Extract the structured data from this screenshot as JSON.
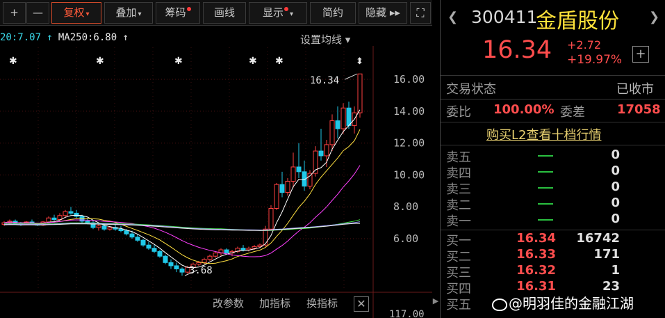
{
  "toolbar": {
    "buttons": [
      {
        "label": "+"
      },
      {
        "label": "—"
      },
      {
        "label": "复权",
        "caret": "▾"
      },
      {
        "label": "叠加",
        "caret": "▾"
      },
      {
        "label": "筹码"
      },
      {
        "label": "画线"
      },
      {
        "label": "显示",
        "caret": "▾"
      },
      {
        "label": "简约"
      },
      {
        "label": "隐藏 ▸▸"
      },
      {
        "label": "⛶"
      }
    ]
  },
  "chart": {
    "ma_legend": {
      "ma20": "20:7.07 ↑",
      "ma250": "MA250:6.80 ↑"
    },
    "ma_setting": "设置均线 ▾",
    "max_label": "16.34",
    "min_label": "3.68",
    "footer": {
      "params": "改参数",
      "add_indicator": "加指标",
      "switch_indicator": "换指标",
      "close": "✕"
    },
    "colors": {
      "up": "#ff4040",
      "down": "#20c8e8",
      "ma5": "#ffffff",
      "ma10": "#ffe040",
      "ma20": "#ff40ff",
      "ma60": "#40e040",
      "ma120": "#a0a0ff",
      "ma250": "#e8e8e8",
      "grid": "#5a1a1a"
    }
  },
  "chart_data": {
    "type": "candlestick",
    "yaxis_ticks": [
      "16.00",
      "14.00",
      "12.00",
      "10.00",
      "8.00",
      "6.00"
    ],
    "ylim": [
      5.0,
      16.8
    ],
    "bottom_tick": "117.00",
    "max_marker": 16.34,
    "min_marker": 3.68,
    "candles": [
      [
        6.9,
        7.1,
        6.8,
        7.0
      ],
      [
        7.0,
        7.2,
        6.9,
        7.1
      ],
      [
        7.1,
        7.2,
        6.9,
        6.95
      ],
      [
        6.95,
        7.05,
        6.8,
        6.9
      ],
      [
        6.9,
        7.1,
        6.85,
        7.05
      ],
      [
        7.05,
        7.2,
        6.9,
        6.95
      ],
      [
        6.95,
        7.0,
        6.8,
        6.85
      ],
      [
        6.85,
        7.1,
        6.8,
        7.05
      ],
      [
        7.05,
        7.4,
        7.0,
        7.3
      ],
      [
        7.3,
        7.5,
        7.1,
        7.2
      ],
      [
        7.2,
        7.6,
        7.1,
        7.45
      ],
      [
        7.45,
        7.8,
        7.3,
        7.7
      ],
      [
        7.7,
        8.0,
        7.5,
        7.6
      ],
      [
        7.6,
        7.8,
        7.3,
        7.4
      ],
      [
        7.4,
        7.5,
        7.0,
        7.1
      ],
      [
        7.1,
        7.3,
        6.9,
        7.0
      ],
      [
        7.0,
        7.1,
        6.6,
        6.7
      ],
      [
        6.7,
        6.9,
        6.5,
        6.8
      ],
      [
        6.8,
        6.9,
        6.5,
        6.6
      ],
      [
        6.6,
        6.8,
        6.5,
        6.7
      ],
      [
        6.7,
        6.9,
        6.5,
        6.6
      ],
      [
        6.6,
        6.8,
        6.4,
        6.5
      ],
      [
        6.5,
        6.6,
        6.2,
        6.3
      ],
      [
        6.3,
        6.5,
        6.0,
        6.1
      ],
      [
        6.1,
        6.3,
        5.8,
        5.9
      ],
      [
        5.9,
        6.0,
        5.5,
        5.6
      ],
      [
        5.6,
        5.8,
        5.3,
        5.4
      ],
      [
        5.4,
        5.6,
        5.1,
        5.2
      ],
      [
        5.2,
        5.3,
        4.8,
        4.9
      ],
      [
        4.9,
        5.0,
        4.4,
        4.5
      ],
      [
        4.5,
        4.7,
        4.1,
        4.3
      ],
      [
        4.3,
        4.5,
        3.9,
        4.1
      ],
      [
        4.1,
        4.2,
        3.68,
        3.9
      ],
      [
        3.9,
        4.3,
        3.8,
        4.2
      ],
      [
        4.2,
        4.5,
        4.1,
        4.4
      ],
      [
        4.4,
        4.6,
        4.3,
        4.5
      ],
      [
        4.5,
        4.8,
        4.4,
        4.7
      ],
      [
        4.7,
        5.0,
        4.6,
        4.9
      ],
      [
        4.9,
        5.2,
        4.8,
        5.1
      ],
      [
        5.1,
        5.4,
        4.9,
        5.3
      ],
      [
        5.3,
        5.4,
        5.0,
        5.1
      ],
      [
        5.1,
        5.3,
        4.9,
        5.2
      ],
      [
        5.2,
        5.5,
        5.1,
        5.4
      ],
      [
        5.4,
        5.6,
        5.2,
        5.3
      ],
      [
        5.3,
        5.5,
        5.2,
        5.4
      ],
      [
        5.4,
        5.6,
        5.3,
        5.5
      ],
      [
        5.5,
        5.7,
        5.4,
        5.6
      ],
      [
        5.6,
        6.8,
        5.5,
        6.6
      ],
      [
        6.6,
        8.1,
        6.5,
        7.9
      ],
      [
        7.9,
        9.5,
        7.8,
        9.4
      ],
      [
        9.4,
        10.2,
        8.6,
        8.9
      ],
      [
        8.9,
        9.8,
        8.7,
        9.6
      ],
      [
        9.6,
        11.4,
        9.2,
        10.5
      ],
      [
        10.5,
        12.0,
        9.8,
        10.2
      ],
      [
        10.2,
        10.9,
        9.0,
        9.3
      ],
      [
        9.3,
        10.3,
        9.1,
        10.1
      ],
      [
        10.1,
        11.8,
        9.9,
        11.5
      ],
      [
        11.5,
        12.9,
        10.9,
        11.2
      ],
      [
        11.2,
        12.2,
        10.5,
        11.9
      ],
      [
        11.9,
        13.8,
        11.5,
        13.4
      ],
      [
        13.4,
        14.3,
        12.3,
        12.9
      ],
      [
        12.9,
        14.5,
        12.6,
        14.2
      ],
      [
        14.2,
        14.6,
        12.9,
        13.1
      ],
      [
        13.1,
        14.3,
        12.6,
        13.9
      ],
      [
        13.9,
        16.34,
        13.6,
        16.34
      ]
    ]
  },
  "quote": {
    "prev_icon": "❮",
    "next_icon": "❯",
    "code": "300411",
    "name": "金盾股份",
    "price": "16.34",
    "change_abs": "+2.72",
    "change_pct": "+19.97%",
    "add_label": "+",
    "status_label": "交易状态",
    "status_value": "已收市",
    "weibi_label": "委比",
    "weibi_value": "100.00%",
    "weicha_label": "委差",
    "weicha_value": "17058",
    "l2_link": "购买L2查看十档行情",
    "asks": [
      {
        "label": "卖五",
        "vol": "0"
      },
      {
        "label": "卖四",
        "vol": "0"
      },
      {
        "label": "卖三",
        "vol": "0"
      },
      {
        "label": "卖二",
        "vol": "0"
      },
      {
        "label": "卖一",
        "vol": "0"
      }
    ],
    "bids": [
      {
        "label": "买一",
        "price": "16.34",
        "vol": "16742"
      },
      {
        "label": "买二",
        "price": "16.33",
        "vol": "171"
      },
      {
        "label": "买三",
        "price": "16.32",
        "vol": "1"
      },
      {
        "label": "买四",
        "price": "16.31",
        "vol": "23"
      },
      {
        "label": "买五",
        "price": "",
        "vol": ""
      }
    ]
  },
  "watermark": "@明羽佳的金融江湖"
}
